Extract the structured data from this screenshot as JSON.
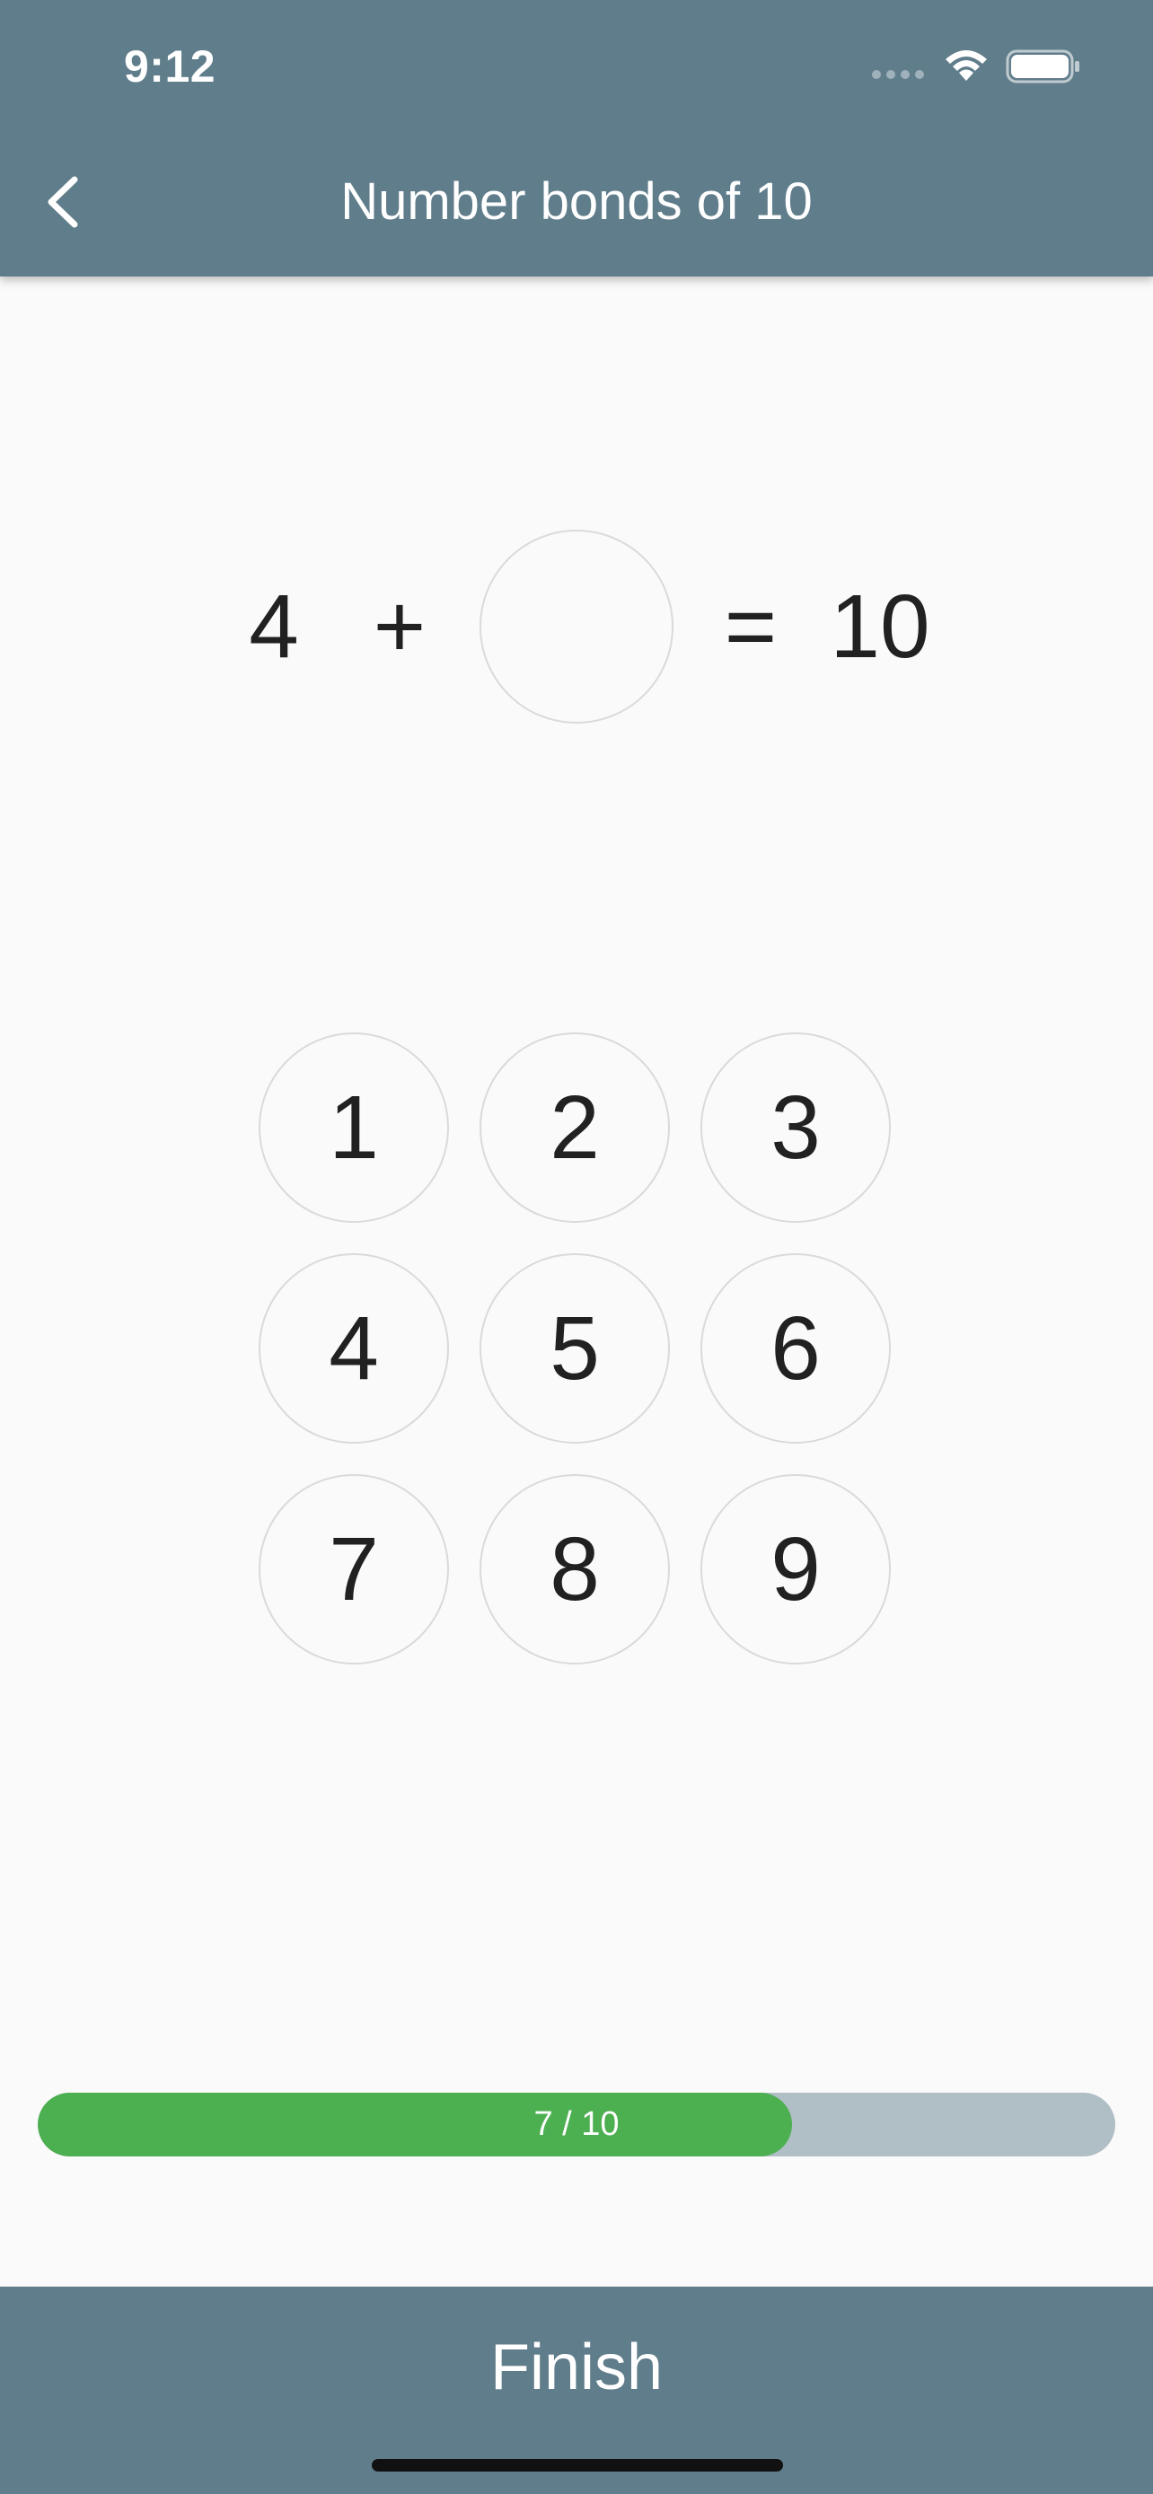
{
  "status_bar": {
    "time": "9:12"
  },
  "app_bar": {
    "title": "Number bonds of 10",
    "back_icon": "chevron-left-icon"
  },
  "equation": {
    "addend": "4",
    "operator": "+",
    "equals": "=",
    "total": "10",
    "answer": ""
  },
  "keypad": {
    "keys": [
      "1",
      "2",
      "3",
      "4",
      "5",
      "6",
      "7",
      "8",
      "9"
    ]
  },
  "progress": {
    "label": "7 / 10",
    "current": 7,
    "total": 10,
    "fill_color": "#4CAF50",
    "track_color": "#B0BEC5"
  },
  "footer": {
    "finish_label": "Finish"
  },
  "colors": {
    "primary": "#607D8B",
    "background": "#FAFAFA"
  }
}
